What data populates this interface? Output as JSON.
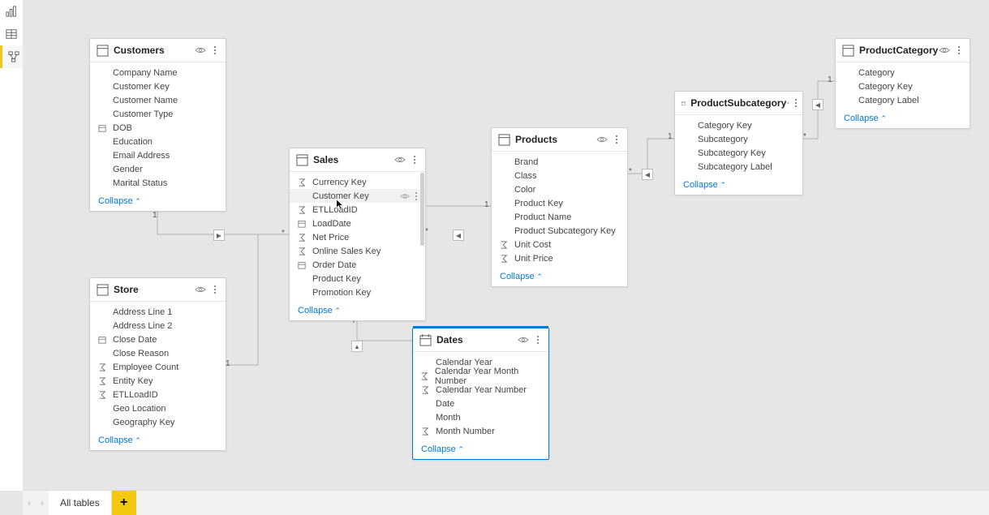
{
  "rail": {
    "items": [
      "report",
      "table",
      "model"
    ],
    "active": "model"
  },
  "tabs": {
    "prev": "‹",
    "next": "›",
    "items": [
      "All tables"
    ],
    "add": "+"
  },
  "collapse_label": "Collapse",
  "cursor_field": "Customer Key",
  "tables": {
    "customers": {
      "title": "Customers",
      "fields": [
        {
          "name": "Company Name"
        },
        {
          "name": "Customer Key"
        },
        {
          "name": "Customer Name"
        },
        {
          "name": "Customer Type"
        },
        {
          "name": "DOB",
          "icon": "date"
        },
        {
          "name": "Education"
        },
        {
          "name": "Email Address"
        },
        {
          "name": "Gender"
        },
        {
          "name": "Marital Status"
        }
      ]
    },
    "sales": {
      "title": "Sales",
      "fields": [
        {
          "name": "Currency Key",
          "icon": "sum"
        },
        {
          "name": "Customer Key",
          "hover": true,
          "tail": true
        },
        {
          "name": "ETLLoadID",
          "icon": "sum"
        },
        {
          "name": "LoadDate",
          "icon": "date"
        },
        {
          "name": "Net Price",
          "icon": "sum"
        },
        {
          "name": "Online Sales Key",
          "icon": "sum"
        },
        {
          "name": "Order Date",
          "icon": "date"
        },
        {
          "name": "Product Key"
        },
        {
          "name": "Promotion Key"
        }
      ]
    },
    "products": {
      "title": "Products",
      "fields": [
        {
          "name": "Brand"
        },
        {
          "name": "Class"
        },
        {
          "name": "Color"
        },
        {
          "name": "Product Key"
        },
        {
          "name": "Product Name"
        },
        {
          "name": "Product Subcategory Key"
        },
        {
          "name": "Unit Cost",
          "icon": "sum"
        },
        {
          "name": "Unit Price",
          "icon": "sum"
        }
      ]
    },
    "subcat": {
      "title": "ProductSubcategory",
      "fields": [
        {
          "name": "Category Key"
        },
        {
          "name": "Subcategory"
        },
        {
          "name": "Subcategory Key"
        },
        {
          "name": "Subcategory Label"
        }
      ]
    },
    "cat": {
      "title": "ProductCategory",
      "fields": [
        {
          "name": "Category"
        },
        {
          "name": "Category Key"
        },
        {
          "name": "Category Label"
        }
      ]
    },
    "store": {
      "title": "Store",
      "fields": [
        {
          "name": "Address Line 1"
        },
        {
          "name": "Address Line 2"
        },
        {
          "name": "Close Date",
          "icon": "date"
        },
        {
          "name": "Close Reason"
        },
        {
          "name": "Employee Count",
          "icon": "sum"
        },
        {
          "name": "Entity Key",
          "icon": "sum"
        },
        {
          "name": "ETLLoadID",
          "icon": "sum"
        },
        {
          "name": "Geo Location"
        },
        {
          "name": "Geography Key"
        }
      ]
    },
    "dates": {
      "title": "Dates",
      "fields": [
        {
          "name": "Calendar Year"
        },
        {
          "name": "Calendar Year Month Number",
          "icon": "sum"
        },
        {
          "name": "Calendar Year Number",
          "icon": "sum"
        },
        {
          "name": "Date"
        },
        {
          "name": "Month"
        },
        {
          "name": "Month Number",
          "icon": "sum"
        }
      ]
    }
  },
  "relationships": [
    {
      "from": "customers",
      "to": "sales",
      "from_card": "1",
      "to_card": "*"
    },
    {
      "from": "store",
      "to": "sales",
      "from_card": "1",
      "to_card": "*"
    },
    {
      "from": "products",
      "to": "sales",
      "from_card": "1",
      "to_card": "*"
    },
    {
      "from": "subcat",
      "to": "products",
      "from_card": "1",
      "to_card": "*"
    },
    {
      "from": "cat",
      "to": "subcat",
      "from_card": "1",
      "to_card": "*"
    },
    {
      "from": "dates",
      "to": "sales",
      "from_card": "1",
      "to_card": "*"
    }
  ]
}
